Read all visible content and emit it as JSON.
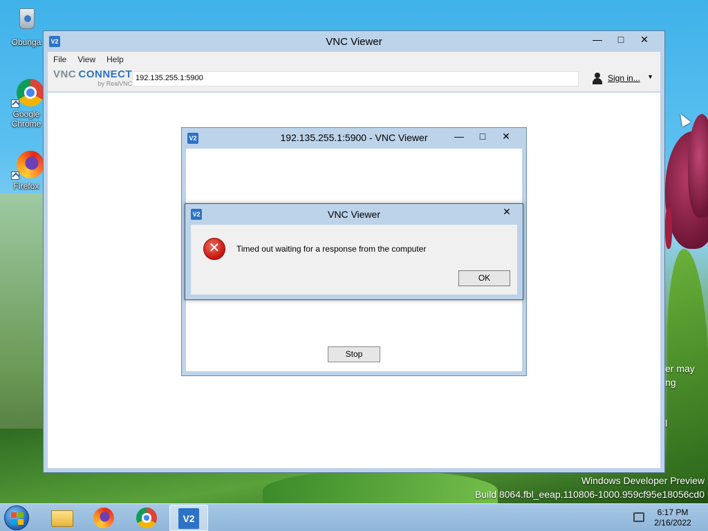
{
  "desktop": {
    "icons": [
      {
        "label": "Obunga"
      },
      {
        "label": "Google Chrome"
      },
      {
        "label": "Firefox"
      }
    ],
    "watermark_line1": "Windows Developer Preview",
    "watermark_line2": "Build 8064.fbl_eeap.110806-1000.959cf95e18056cd0",
    "peek_text_1": "er may",
    "peek_text_2": "ng",
    "peek_text_3": "l"
  },
  "main_window": {
    "logo": "V2",
    "title": "VNC Viewer",
    "minimize_icon": "—",
    "maximize_icon": "□",
    "close_icon": "✕",
    "menu": [
      "File",
      "View",
      "Help"
    ],
    "brand_vnc": "VNC",
    "brand_connect": "CONNECT",
    "brand_by": "by RealVNC",
    "address_value": "192.135.255.1:5900",
    "signin_label": "Sign in...",
    "signin_chevron": "▼"
  },
  "connection_window": {
    "logo": "V2",
    "title": "192.135.255.1:5900 - VNC Viewer",
    "minimize_icon": "—",
    "maximize_icon": "□",
    "close_icon": "✕",
    "stop_label": "Stop"
  },
  "error_dialog": {
    "logo": "V2",
    "title": "VNC Viewer",
    "close_icon": "✕",
    "error_glyph": "✕",
    "message": "Timed out waiting for a response from the computer",
    "ok_label": "OK"
  },
  "taskbar": {
    "items": [
      "start-button",
      "file-explorer",
      "firefox",
      "google-chrome",
      "vnc-viewer"
    ],
    "vnc_logo": "V2",
    "time": "6:17 PM",
    "date": "2/16/2022"
  }
}
